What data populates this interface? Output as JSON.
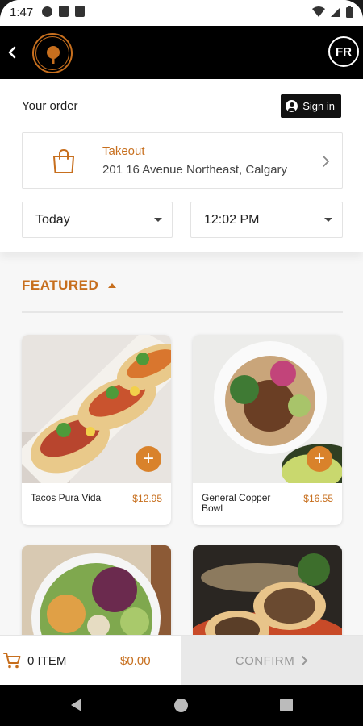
{
  "status_bar": {
    "time": "1:47"
  },
  "header": {
    "language_label": "FR"
  },
  "order": {
    "title": "Your order",
    "sign_in_label": "Sign in",
    "mode_label": "Takeout",
    "address": "201 16 Avenue Northeast, Calgary",
    "day": "Today",
    "time": "12:02 PM"
  },
  "featured": {
    "title": "FEATURED",
    "items": [
      {
        "name": "Tacos Pura Vida",
        "price": "$12.95"
      },
      {
        "name": "General Copper Bowl",
        "price": "$16.55"
      },
      {
        "name": "",
        "price": ""
      },
      {
        "name": "",
        "price": ""
      }
    ]
  },
  "cart": {
    "count_label": "0 ITEM",
    "total": "$0.00",
    "confirm_label": "CONFIRM"
  },
  "colors": {
    "accent": "#c76f1e",
    "add_button": "#d9822b",
    "appbar": "#000000"
  }
}
